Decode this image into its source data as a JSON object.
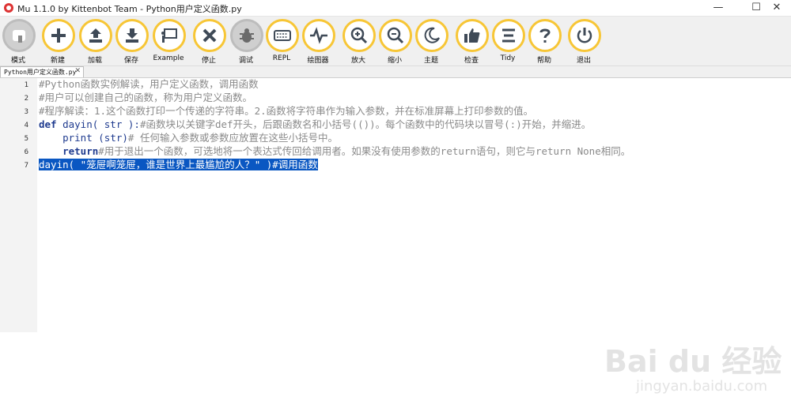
{
  "window": {
    "title": "Mu 1.1.0 by Kittenbot Team - Python用户定义函数.py",
    "controls": {
      "minimize": "—",
      "maximize": "☐",
      "close": "✕"
    }
  },
  "toolbar": {
    "accent_color": "#f7c636",
    "buttons": [
      {
        "label": "模式",
        "icon": "mode-icon"
      },
      {
        "label": "新建",
        "icon": "plus-icon"
      },
      {
        "label": "加载",
        "icon": "upload-icon"
      },
      {
        "label": "保存",
        "icon": "download-icon"
      },
      {
        "label": "Example",
        "icon": "presentation-icon"
      },
      {
        "label": "停止",
        "icon": "close-icon"
      },
      {
        "label": "调试",
        "icon": "bug-icon"
      },
      {
        "label": "REPL",
        "icon": "keyboard-icon"
      },
      {
        "label": "绘图器",
        "icon": "wave-icon"
      },
      {
        "label": "放大",
        "icon": "zoom-in-icon"
      },
      {
        "label": "缩小",
        "icon": "zoom-out-icon"
      },
      {
        "label": "主题",
        "icon": "moon-icon"
      },
      {
        "label": "检查",
        "icon": "thumbs-up-icon"
      },
      {
        "label": "Tidy",
        "icon": "align-icon"
      },
      {
        "label": "帮助",
        "icon": "help-icon"
      },
      {
        "label": "退出",
        "icon": "power-icon"
      }
    ]
  },
  "tabs": [
    {
      "label": "Python用户定义函数.py",
      "close": "✕"
    }
  ],
  "editor": {
    "line_numbers": [
      "1",
      "2",
      "3",
      "4",
      "5",
      "6",
      "7"
    ],
    "lines": {
      "l1": "#Python函数实例解读，用户定义函数，调用函数",
      "l2": "#用户可以创建自己的函数，称为用户定义函数。",
      "l3": "#程序解读：1.这个函数打印一个传递的字符串。2.函数将字符串作为输入参数，并在标准屏幕上打印参数的值。",
      "l4_kw": "def",
      "l4_code": " dayin( str ):",
      "l4_comment": "#函数块以关键字def开头，后跟函数名和小括号(())。每个函数中的代码块以冒号(:)开始，并缩进。",
      "l5_indent": "    ",
      "l5_code": "print (str)",
      "l5_comment": "# 任何输入参数或参数应放置在这些小括号中。",
      "l6_indent": "    ",
      "l6_kw": "return",
      "l6_comment": "#用于退出一个函数，可选地将一个表达式传回给调用者。如果没有使用参数的return语句，则它与return None相同。",
      "l7": "dayin( \"笼屉啊笼屉，谁是世界上最尴尬的人？\" )#调用函数"
    }
  },
  "watermark": {
    "brand": "Bai du 经验",
    "url": "jingyan.baidu.com"
  }
}
